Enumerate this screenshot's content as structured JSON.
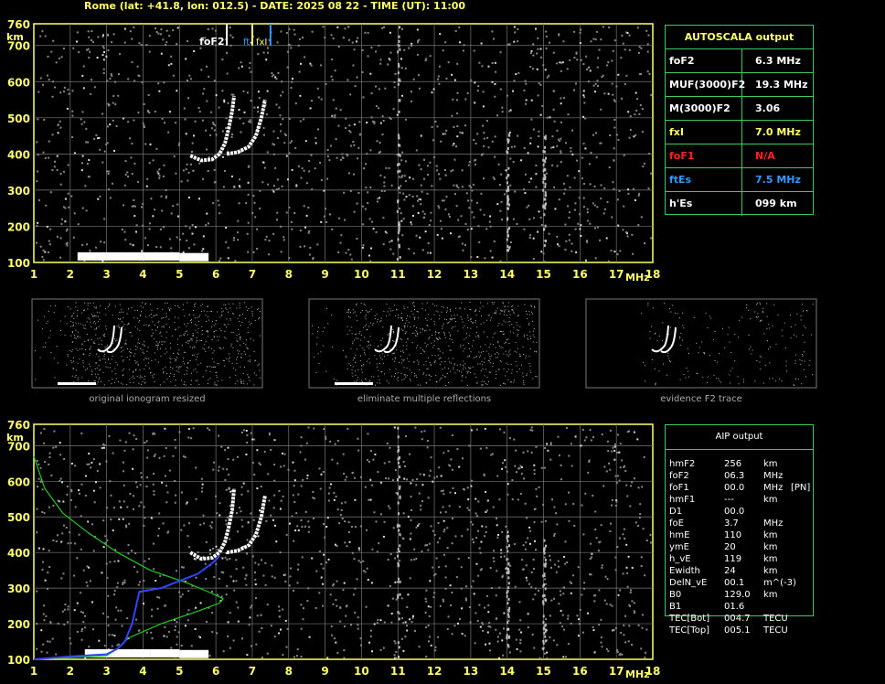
{
  "header": "Rome (lat: +41.8, lon: 012.5) - DATE: 2025 08 22 - TIME (UT): 11:00",
  "colors": {
    "axis": "#ffff66",
    "grid": "#777777",
    "profile_green": "#22cc22",
    "profile_blue": "#3344ff",
    "border_green": "#33cc66",
    "fxi": "#ffff66",
    "fof1": "#ff2222",
    "ftes": "#3399ff"
  },
  "chart_data": [
    {
      "type": "scatter",
      "name_role": "main ionogram (AUTOSCALA)",
      "x_ticks": [
        "1",
        "2",
        "3",
        "4",
        "5",
        "6",
        "7",
        "8",
        "9",
        "10",
        "11",
        "12",
        "13",
        "14",
        "15",
        "16",
        "17",
        "18"
      ],
      "y_ticks": [
        "100",
        "200",
        "300",
        "400",
        "500",
        "600",
        "700",
        "760"
      ],
      "xlim": [
        1,
        18
      ],
      "ylim": [
        100,
        760
      ],
      "x_unit": "MHz",
      "y_unit": "km",
      "annotations": [
        "foF2",
        "ft",
        "fxI"
      ],
      "markers_mhz": {
        "foF2": 6.3,
        "ft": 7.0,
        "fxI": 7.5
      },
      "traces": {
        "o_trace": [
          [
            5.3,
            395
          ],
          [
            5.6,
            382
          ],
          [
            5.9,
            385
          ],
          [
            6.1,
            400
          ],
          [
            6.25,
            430
          ],
          [
            6.35,
            470
          ],
          [
            6.45,
            520
          ],
          [
            6.5,
            560
          ]
        ],
        "x_trace": [
          [
            6.3,
            400
          ],
          [
            6.6,
            405
          ],
          [
            6.9,
            420
          ],
          [
            7.1,
            450
          ],
          [
            7.25,
            500
          ],
          [
            7.35,
            550
          ]
        ],
        "es_layer": [
          [
            2.2,
            112
          ],
          [
            3.0,
            118
          ],
          [
            4.0,
            118
          ],
          [
            5.0,
            116
          ],
          [
            5.8,
            114
          ]
        ]
      }
    },
    {
      "type": "scatter",
      "name_role": "main ionogram (AIP)",
      "x_ticks": [
        "1",
        "2",
        "3",
        "4",
        "5",
        "6",
        "7",
        "8",
        "9",
        "10",
        "11",
        "12",
        "13",
        "14",
        "15",
        "16",
        "17",
        "18"
      ],
      "y_ticks": [
        "100",
        "200",
        "300",
        "400",
        "500",
        "600",
        "700",
        "760"
      ],
      "xlim": [
        1,
        18
      ],
      "ylim": [
        100,
        760
      ],
      "x_unit": "MHz",
      "y_unit": "km",
      "traces": {
        "o_trace": [
          [
            5.3,
            400
          ],
          [
            5.6,
            382
          ],
          [
            5.9,
            385
          ],
          [
            6.1,
            400
          ],
          [
            6.25,
            430
          ],
          [
            6.35,
            470
          ],
          [
            6.45,
            520
          ],
          [
            6.5,
            580
          ]
        ],
        "x_trace": [
          [
            6.3,
            400
          ],
          [
            6.6,
            405
          ],
          [
            6.9,
            420
          ],
          [
            7.1,
            450
          ],
          [
            7.25,
            500
          ],
          [
            7.35,
            560
          ]
        ],
        "es_layer": [
          [
            2.4,
            112
          ],
          [
            3.2,
            118
          ],
          [
            4.2,
            118
          ],
          [
            5.0,
            116
          ],
          [
            5.8,
            114
          ]
        ]
      },
      "profile_green": [
        [
          1.0,
          670
        ],
        [
          1.3,
          580
        ],
        [
          1.8,
          510
        ],
        [
          2.5,
          455
        ],
        [
          3.3,
          400
        ],
        [
          4.2,
          350
        ],
        [
          5.2,
          315
        ],
        [
          5.9,
          285
        ],
        [
          6.2,
          270
        ],
        [
          6.1,
          258
        ],
        [
          5.5,
          235
        ],
        [
          4.5,
          200
        ],
        [
          3.6,
          160
        ],
        [
          3.3,
          130
        ],
        [
          3.0,
          110
        ],
        [
          1.0,
          100
        ]
      ],
      "profile_blue": [
        [
          1.0,
          100
        ],
        [
          2.0,
          108
        ],
        [
          3.0,
          114
        ],
        [
          3.3,
          130
        ],
        [
          3.5,
          150
        ],
        [
          3.7,
          200
        ],
        [
          3.9,
          290
        ],
        [
          4.5,
          300
        ],
        [
          5.5,
          340
        ],
        [
          5.9,
          370
        ],
        [
          6.1,
          390
        ]
      ]
    }
  ],
  "thumbnails": [
    {
      "caption": "original ionogram resized"
    },
    {
      "caption": "eliminate multiple reflections"
    },
    {
      "caption": "evidence F2 trace"
    }
  ],
  "autoscala": {
    "title": "AUTOSCALA output",
    "rows": [
      {
        "label": "foF2",
        "value": "6.3 MHz"
      },
      {
        "label": "MUF(3000)F2",
        "value": "19.3 MHz"
      },
      {
        "label": "M(3000)F2",
        "value": "3.06"
      },
      {
        "label": "fxI",
        "value": "7.0 MHz"
      },
      {
        "label": "foF1",
        "value": "N/A"
      },
      {
        "label": "ftEs",
        "value": "7.5 MHz"
      },
      {
        "label": "h'Es",
        "value": "099     km"
      }
    ]
  },
  "aip": {
    "title": "AIP output",
    "rows": [
      {
        "label": "hmF2",
        "value": "256",
        "unit": "km",
        "extra": ""
      },
      {
        "label": "foF2",
        "value": "06.3",
        "unit": "MHz",
        "extra": ""
      },
      {
        "label": "foF1",
        "value": "00.0",
        "unit": "MHz",
        "extra": "[PN]"
      },
      {
        "label": "hmF1",
        "value": "---",
        "unit": "km",
        "extra": ""
      },
      {
        "label": "D1",
        "value": "00.0",
        "unit": "",
        "extra": ""
      },
      {
        "label": "foE",
        "value": "3.7",
        "unit": "MHz",
        "extra": ""
      },
      {
        "label": "hmE",
        "value": "110",
        "unit": "km",
        "extra": ""
      },
      {
        "label": "ymE",
        "value": "20",
        "unit": "km",
        "extra": ""
      },
      {
        "label": "h_vE",
        "value": "119",
        "unit": "km",
        "extra": ""
      },
      {
        "label": "Ewidth",
        "value": "24",
        "unit": "km",
        "extra": ""
      },
      {
        "label": "DelN_vE",
        "value": "00.1",
        "unit": "m^(-3)",
        "extra": ""
      },
      {
        "label": "B0",
        "value": "129.0",
        "unit": "km",
        "extra": ""
      },
      {
        "label": "B1",
        "value": "01.6",
        "unit": "",
        "extra": ""
      },
      {
        "label": "TEC[Bot]",
        "value": "004.7",
        "unit": "TECU",
        "extra": ""
      },
      {
        "label": "TEC[Top]",
        "value": "005.1",
        "unit": "TECU",
        "extra": ""
      }
    ]
  }
}
